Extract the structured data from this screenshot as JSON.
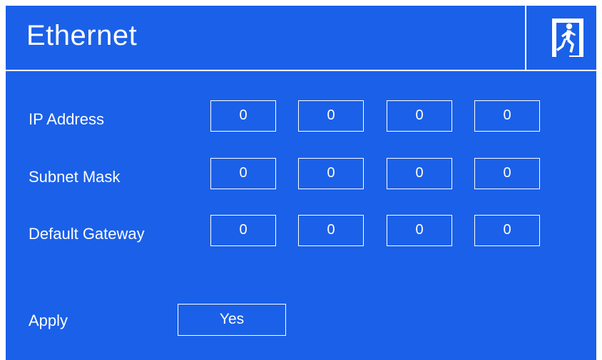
{
  "screen": {
    "title": "Ethernet",
    "exit_icon": "emergency-exit-icon"
  },
  "network": {
    "rows": [
      {
        "label": "IP Address",
        "octets": [
          "0",
          "0",
          "0",
          "0"
        ]
      },
      {
        "label": "Subnet Mask",
        "octets": [
          "0",
          "0",
          "0",
          "0"
        ]
      },
      {
        "label": "Default Gateway",
        "octets": [
          "0",
          "0",
          "0",
          "0"
        ]
      }
    ]
  },
  "apply": {
    "label": "Apply",
    "button_label": "Yes"
  },
  "colors": {
    "background": "#1b60e8",
    "foreground": "#ffffff"
  }
}
